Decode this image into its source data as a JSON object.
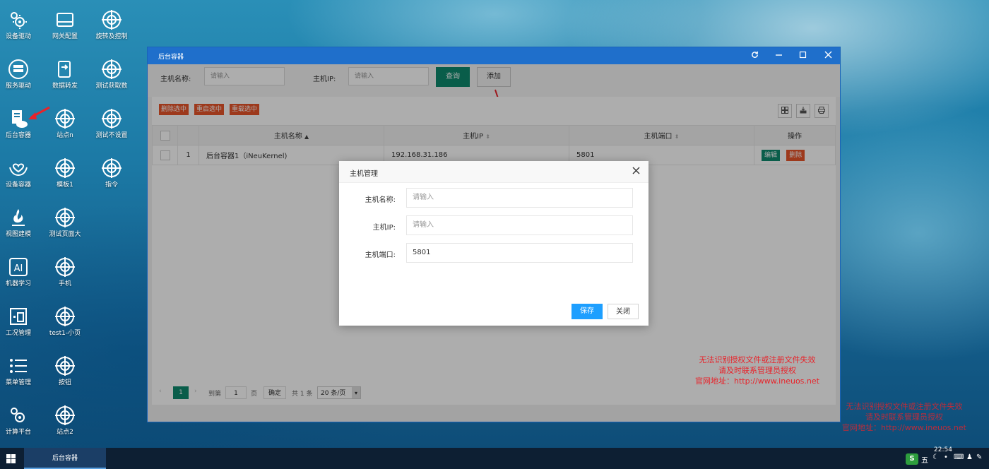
{
  "desktop": {
    "icons": [
      {
        "label": "设备驱动",
        "icon": "gear-cog-icon"
      },
      {
        "label": "网关配置",
        "icon": "gateway-icon"
      },
      {
        "label": "旋转及控制",
        "icon": "target-icon"
      },
      {
        "label": "服务驱动",
        "icon": "server-icon"
      },
      {
        "label": "数据转发",
        "icon": "forward-doc-icon"
      },
      {
        "label": "测试获取数",
        "icon": "target-icon"
      },
      {
        "label": "后台容器",
        "icon": "cloud-doc-icon"
      },
      {
        "label": "站点n",
        "icon": "target-icon"
      },
      {
        "label": "测试不设置",
        "icon": "target-icon"
      },
      {
        "label": "设备容器",
        "icon": "hands-heart-icon"
      },
      {
        "label": "模板1",
        "icon": "target-icon"
      },
      {
        "label": "指令",
        "icon": "target-icon"
      },
      {
        "label": "视图建模",
        "icon": "flame-icon"
      },
      {
        "label": "测试页面大",
        "icon": "target-icon"
      },
      {
        "label": "机器学习",
        "icon": "ai-icon"
      },
      {
        "label": "手机",
        "icon": "target-icon"
      },
      {
        "label": "工况管理",
        "icon": "building-icon"
      },
      {
        "label": "test1-小页",
        "icon": "target-icon"
      },
      {
        "label": "菜单管理",
        "icon": "list-icon"
      },
      {
        "label": "按钮",
        "icon": "target-icon"
      },
      {
        "label": "计算平台",
        "icon": "gear-cog-icon"
      },
      {
        "label": "站点2",
        "icon": "target-icon"
      }
    ],
    "watermark_lines": [
      "无法识别授权文件或注册文件失效",
      "请及时联系管理员授权",
      "官网地址：http://www.ineuos.net"
    ]
  },
  "window": {
    "title": "后台容器",
    "search": {
      "host_name_label": "主机名称:",
      "host_name_placeholder": "请输入",
      "host_ip_label": "主机IP:",
      "host_ip_placeholder": "请输入",
      "query_label": "查询",
      "add_label": "添加"
    },
    "toolbar": {
      "delete_selected": "删除选中",
      "restart_selected": "重启选中",
      "reload_selected": "重载选中"
    },
    "table": {
      "headers": {
        "name": "主机名称",
        "ip": "主机IP",
        "port": "主机端口",
        "actions": "操作"
      },
      "rows": [
        {
          "index": "1",
          "name": "后台容器1（iNeuKernel)",
          "ip": "192.168.31.186",
          "port": "5801",
          "edit": "编辑",
          "delete": "删除"
        }
      ]
    },
    "pager": {
      "current_page": "1",
      "goto_label": "到第",
      "goto_value": "1",
      "page_unit": "页",
      "confirm": "确定",
      "total": "共 1 条",
      "per_page": "20 条/页"
    }
  },
  "modal": {
    "title": "主机管理",
    "fields": {
      "name_label": "主机名称:",
      "name_placeholder": "请输入",
      "ip_label": "主机IP:",
      "ip_placeholder": "请输入",
      "port_label": "主机端口:",
      "port_value": "5801"
    },
    "save_label": "保存",
    "close_label": "关闭"
  },
  "taskbar": {
    "active_task": "后台容器",
    "time": "22:54",
    "ime": "五"
  }
}
